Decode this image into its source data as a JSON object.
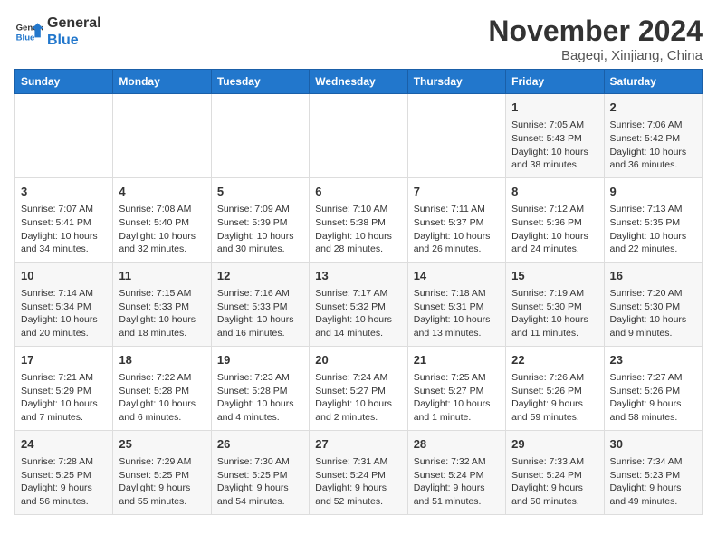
{
  "header": {
    "logo_general": "General",
    "logo_blue": "Blue",
    "month_title": "November 2024",
    "location": "Bageqi, Xinjiang, China"
  },
  "weekdays": [
    "Sunday",
    "Monday",
    "Tuesday",
    "Wednesday",
    "Thursday",
    "Friday",
    "Saturday"
  ],
  "weeks": [
    [
      {
        "day": "",
        "info": ""
      },
      {
        "day": "",
        "info": ""
      },
      {
        "day": "",
        "info": ""
      },
      {
        "day": "",
        "info": ""
      },
      {
        "day": "",
        "info": ""
      },
      {
        "day": "1",
        "info": "Sunrise: 7:05 AM\nSunset: 5:43 PM\nDaylight: 10 hours and 38 minutes."
      },
      {
        "day": "2",
        "info": "Sunrise: 7:06 AM\nSunset: 5:42 PM\nDaylight: 10 hours and 36 minutes."
      }
    ],
    [
      {
        "day": "3",
        "info": "Sunrise: 7:07 AM\nSunset: 5:41 PM\nDaylight: 10 hours and 34 minutes."
      },
      {
        "day": "4",
        "info": "Sunrise: 7:08 AM\nSunset: 5:40 PM\nDaylight: 10 hours and 32 minutes."
      },
      {
        "day": "5",
        "info": "Sunrise: 7:09 AM\nSunset: 5:39 PM\nDaylight: 10 hours and 30 minutes."
      },
      {
        "day": "6",
        "info": "Sunrise: 7:10 AM\nSunset: 5:38 PM\nDaylight: 10 hours and 28 minutes."
      },
      {
        "day": "7",
        "info": "Sunrise: 7:11 AM\nSunset: 5:37 PM\nDaylight: 10 hours and 26 minutes."
      },
      {
        "day": "8",
        "info": "Sunrise: 7:12 AM\nSunset: 5:36 PM\nDaylight: 10 hours and 24 minutes."
      },
      {
        "day": "9",
        "info": "Sunrise: 7:13 AM\nSunset: 5:35 PM\nDaylight: 10 hours and 22 minutes."
      }
    ],
    [
      {
        "day": "10",
        "info": "Sunrise: 7:14 AM\nSunset: 5:34 PM\nDaylight: 10 hours and 20 minutes."
      },
      {
        "day": "11",
        "info": "Sunrise: 7:15 AM\nSunset: 5:33 PM\nDaylight: 10 hours and 18 minutes."
      },
      {
        "day": "12",
        "info": "Sunrise: 7:16 AM\nSunset: 5:33 PM\nDaylight: 10 hours and 16 minutes."
      },
      {
        "day": "13",
        "info": "Sunrise: 7:17 AM\nSunset: 5:32 PM\nDaylight: 10 hours and 14 minutes."
      },
      {
        "day": "14",
        "info": "Sunrise: 7:18 AM\nSunset: 5:31 PM\nDaylight: 10 hours and 13 minutes."
      },
      {
        "day": "15",
        "info": "Sunrise: 7:19 AM\nSunset: 5:30 PM\nDaylight: 10 hours and 11 minutes."
      },
      {
        "day": "16",
        "info": "Sunrise: 7:20 AM\nSunset: 5:30 PM\nDaylight: 10 hours and 9 minutes."
      }
    ],
    [
      {
        "day": "17",
        "info": "Sunrise: 7:21 AM\nSunset: 5:29 PM\nDaylight: 10 hours and 7 minutes."
      },
      {
        "day": "18",
        "info": "Sunrise: 7:22 AM\nSunset: 5:28 PM\nDaylight: 10 hours and 6 minutes."
      },
      {
        "day": "19",
        "info": "Sunrise: 7:23 AM\nSunset: 5:28 PM\nDaylight: 10 hours and 4 minutes."
      },
      {
        "day": "20",
        "info": "Sunrise: 7:24 AM\nSunset: 5:27 PM\nDaylight: 10 hours and 2 minutes."
      },
      {
        "day": "21",
        "info": "Sunrise: 7:25 AM\nSunset: 5:27 PM\nDaylight: 10 hours and 1 minute."
      },
      {
        "day": "22",
        "info": "Sunrise: 7:26 AM\nSunset: 5:26 PM\nDaylight: 9 hours and 59 minutes."
      },
      {
        "day": "23",
        "info": "Sunrise: 7:27 AM\nSunset: 5:26 PM\nDaylight: 9 hours and 58 minutes."
      }
    ],
    [
      {
        "day": "24",
        "info": "Sunrise: 7:28 AM\nSunset: 5:25 PM\nDaylight: 9 hours and 56 minutes."
      },
      {
        "day": "25",
        "info": "Sunrise: 7:29 AM\nSunset: 5:25 PM\nDaylight: 9 hours and 55 minutes."
      },
      {
        "day": "26",
        "info": "Sunrise: 7:30 AM\nSunset: 5:25 PM\nDaylight: 9 hours and 54 minutes."
      },
      {
        "day": "27",
        "info": "Sunrise: 7:31 AM\nSunset: 5:24 PM\nDaylight: 9 hours and 52 minutes."
      },
      {
        "day": "28",
        "info": "Sunrise: 7:32 AM\nSunset: 5:24 PM\nDaylight: 9 hours and 51 minutes."
      },
      {
        "day": "29",
        "info": "Sunrise: 7:33 AM\nSunset: 5:24 PM\nDaylight: 9 hours and 50 minutes."
      },
      {
        "day": "30",
        "info": "Sunrise: 7:34 AM\nSunset: 5:23 PM\nDaylight: 9 hours and 49 minutes."
      }
    ]
  ]
}
